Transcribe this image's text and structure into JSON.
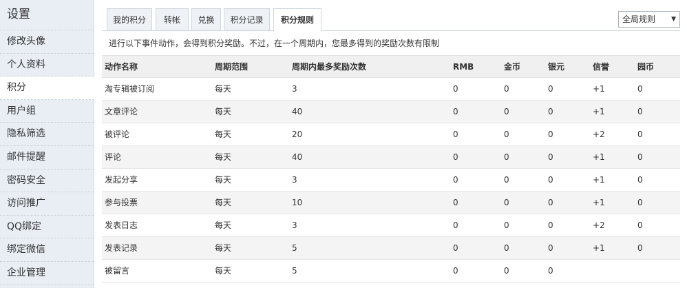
{
  "sidebar": {
    "title": "设置",
    "items": [
      {
        "label": "修改头像",
        "active": false
      },
      {
        "label": "个人资料",
        "active": false
      },
      {
        "label": "积分",
        "active": true
      },
      {
        "label": "用户组",
        "active": false
      },
      {
        "label": "隐私筛选",
        "active": false
      },
      {
        "label": "邮件提醒",
        "active": false
      },
      {
        "label": "密码安全",
        "active": false
      },
      {
        "label": "访问推广",
        "active": false
      },
      {
        "label": "QQ绑定",
        "active": false
      },
      {
        "label": "绑定微信",
        "active": false
      },
      {
        "label": "企业管理",
        "active": false
      }
    ]
  },
  "tabs": [
    {
      "label": "我的积分",
      "active": false
    },
    {
      "label": "转帐",
      "active": false
    },
    {
      "label": "兑换",
      "active": false
    },
    {
      "label": "积分记录",
      "active": false
    },
    {
      "label": "积分规则",
      "active": true
    }
  ],
  "scope_select": {
    "value": "全局规则"
  },
  "note": "进行以下事件动作，会得到积分奖励。不过，在一个周期内，您最多得到的奖励次数有限制",
  "table": {
    "headers": [
      "动作名称",
      "周期范围",
      "周期内最多奖励次数",
      "RMB",
      "金币",
      "银元",
      "信誉",
      "园币"
    ],
    "rows": [
      [
        "淘专辑被订阅",
        "每天",
        "3",
        "0",
        "0",
        "0",
        "+1",
        "0"
      ],
      [
        "文章评论",
        "每天",
        "40",
        "0",
        "0",
        "0",
        "+1",
        "0"
      ],
      [
        "被评论",
        "每天",
        "20",
        "0",
        "0",
        "0",
        "+2",
        "0"
      ],
      [
        "评论",
        "每天",
        "40",
        "0",
        "0",
        "0",
        "+1",
        "0"
      ],
      [
        "发起分享",
        "每天",
        "3",
        "0",
        "0",
        "0",
        "+1",
        "0"
      ],
      [
        "参与投票",
        "每天",
        "10",
        "0",
        "0",
        "0",
        "+1",
        "0"
      ],
      [
        "发表日志",
        "每天",
        "3",
        "0",
        "0",
        "0",
        "+2",
        "0"
      ],
      [
        "发表记录",
        "每天",
        "5",
        "0",
        "0",
        "0",
        "+1",
        "0"
      ],
      [
        "被留言",
        "每天",
        "5",
        "0",
        "0",
        "0",
        "",
        ""
      ]
    ]
  },
  "colors": {
    "sidebar_bg": "#e9eef4",
    "tab_bg": "#eef1f5",
    "header_bg": "#f0f0f0"
  }
}
